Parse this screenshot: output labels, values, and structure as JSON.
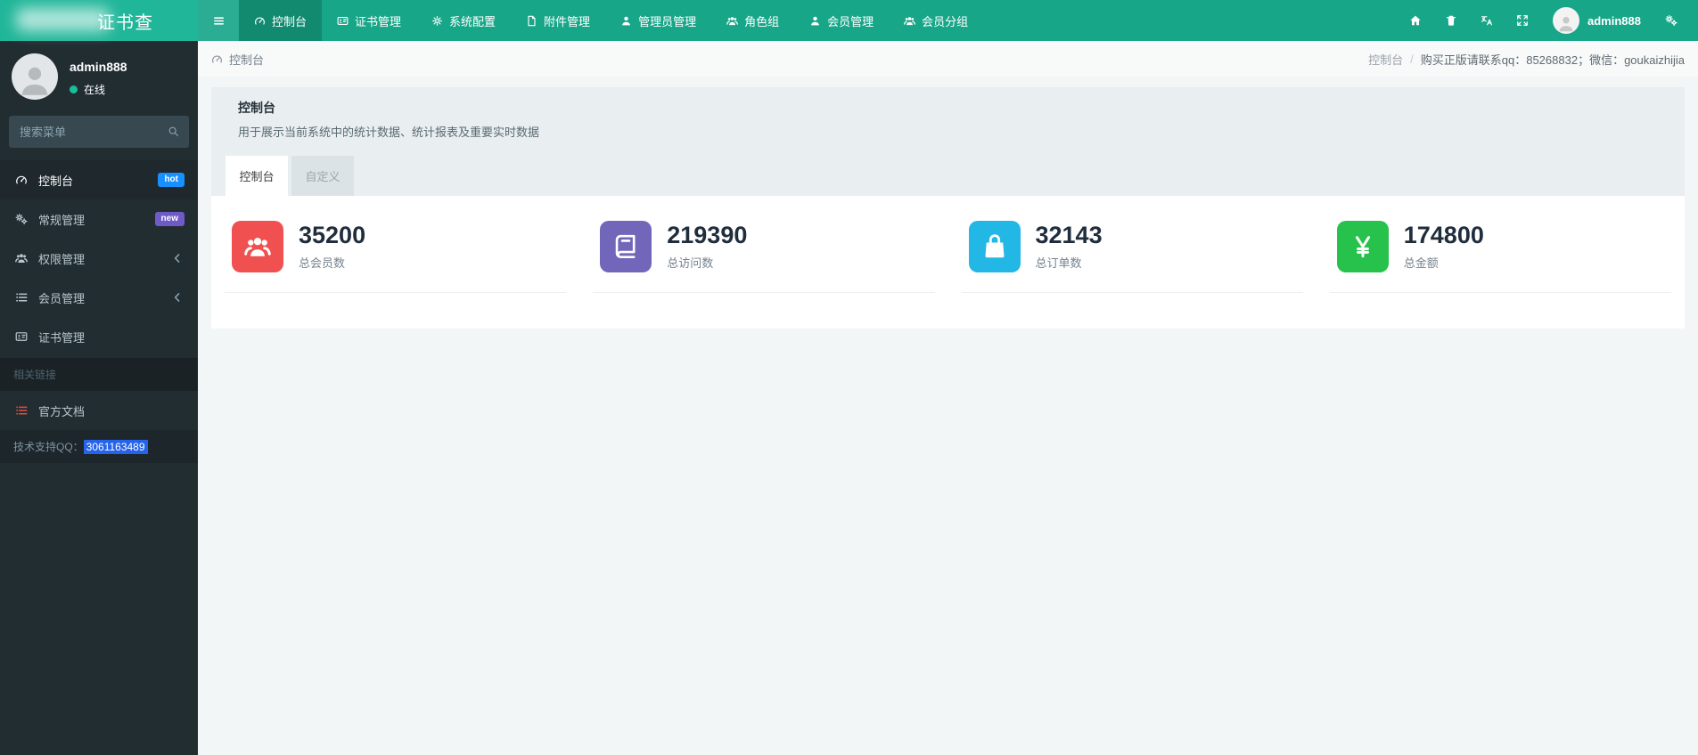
{
  "colors": {
    "navbar": "#18a689",
    "logo_bg": "#20b699",
    "nav_active": "#128a70",
    "online": "#1abc9c",
    "selection": "#2563eb",
    "badge_hot": "#1890ff",
    "badge_new": "#6f5bc8",
    "doc_icon": "#e74c3c"
  },
  "navbar": {
    "logo_text": "证书查",
    "items": [
      {
        "label": "控制台",
        "icon": "gauge"
      },
      {
        "label": "证书管理",
        "icon": "id-card"
      },
      {
        "label": "系统配置",
        "icon": "gear"
      },
      {
        "label": "附件管理",
        "icon": "file"
      },
      {
        "label": "管理员管理",
        "icon": "user"
      },
      {
        "label": "角色组",
        "icon": "users"
      },
      {
        "label": "会员管理",
        "icon": "user"
      },
      {
        "label": "会员分组",
        "icon": "users"
      }
    ],
    "right": {
      "icons": [
        "home",
        "trash",
        "language",
        "expand"
      ],
      "avatar_icon": "user",
      "username": "admin888",
      "settings_icon": "cogs"
    }
  },
  "sidebar": {
    "user": {
      "name": "admin888",
      "status": "在线",
      "avatar_icon": "user"
    },
    "search": {
      "placeholder": "搜索菜单",
      "icon": "search"
    },
    "menu": [
      {
        "label": "控制台",
        "icon": "gauge",
        "badge": {
          "text": "hot"
        }
      },
      {
        "label": "常规管理",
        "icon": "cogs",
        "badge": {
          "text": "new"
        }
      },
      {
        "label": "权限管理",
        "icon": "users",
        "chevron": "chevron-left"
      },
      {
        "label": "会员管理",
        "icon": "list",
        "chevron": "chevron-left"
      },
      {
        "label": "证书管理",
        "icon": "id-card"
      }
    ],
    "section_label": "相关链接",
    "doc_link": {
      "label": "官方文档",
      "icon": "list"
    },
    "support": {
      "prefix": "技术支持QQ：",
      "qq": "3061163489"
    }
  },
  "breadcrumb": {
    "icon": "gauge",
    "label": "控制台",
    "right": {
      "page": "控制台",
      "separator": "/",
      "note": "购买正版请联系qq：85268832；微信：goukaizhijia"
    }
  },
  "panel": {
    "title": "控制台",
    "description": "用于展示当前系统中的统计数据、统计报表及重要实时数据",
    "tabs": [
      {
        "label": "控制台"
      },
      {
        "label": "自定义"
      }
    ],
    "stats": [
      {
        "value": "35200",
        "label": "总会员数",
        "icon": "users",
        "color": "#f05050"
      },
      {
        "value": "219390",
        "label": "总访问数",
        "icon": "book",
        "color": "#7266ba"
      },
      {
        "value": "32143",
        "label": "总订单数",
        "icon": "bag",
        "color": "#23b7e5"
      },
      {
        "value": "174800",
        "label": "总金额",
        "icon": "yen",
        "color": "#27c24c"
      }
    ]
  }
}
